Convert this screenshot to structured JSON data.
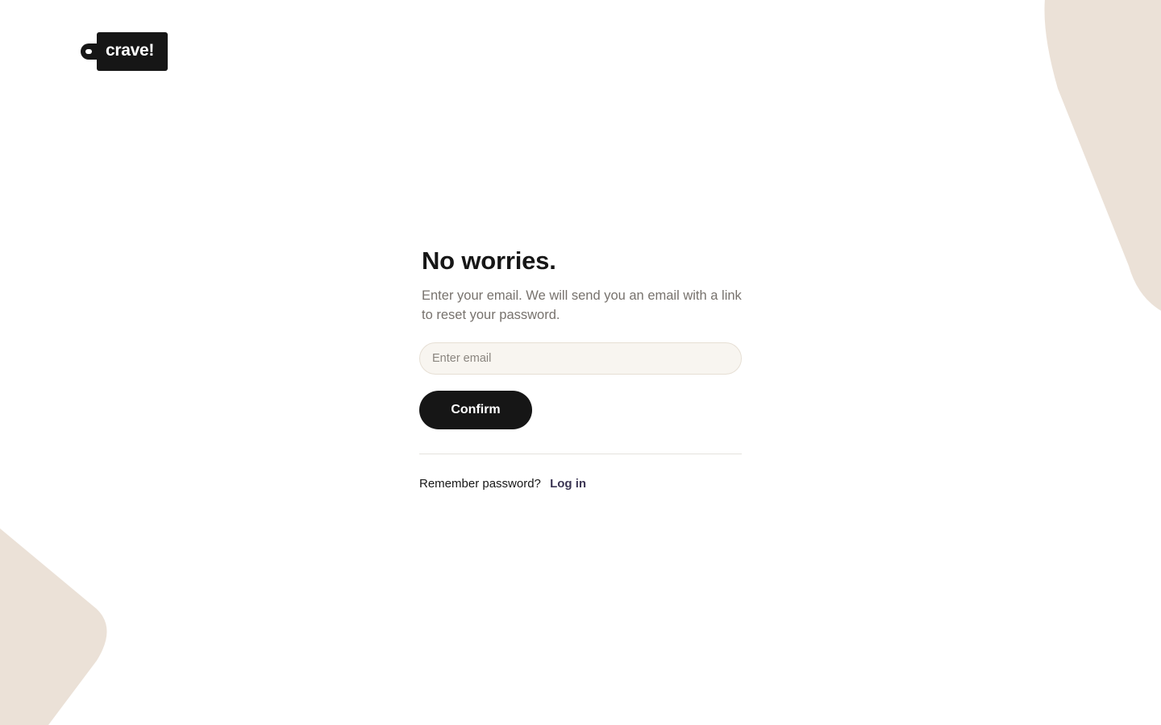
{
  "brand": {
    "logo_text": "crave!",
    "accent_color": "#161616",
    "decor_color": "#ebe1d7"
  },
  "reset_form": {
    "title": "No worries.",
    "subtitle": "Enter your email. We will send you an email with a link to reset your password.",
    "email_value": "",
    "email_placeholder": "Enter email",
    "confirm_label": "Confirm",
    "remember_text": "Remember password?",
    "login_link_label": "Log in",
    "link_color": "#3c3654"
  }
}
